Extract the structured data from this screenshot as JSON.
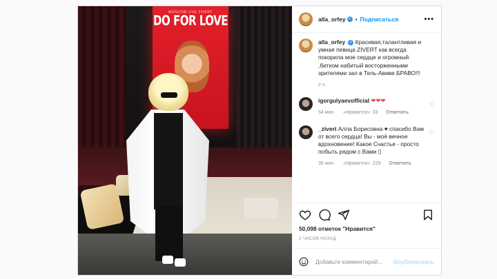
{
  "photo": {
    "screen_small_text": "MOSCOW LIVE ZIVERT",
    "screen_big_text": "DO FOR LOVE"
  },
  "header": {
    "username": "alla_orfey",
    "separator": "•",
    "follow_label": "Подписаться",
    "more_label": "•••"
  },
  "caption": {
    "username": "alla_orfey",
    "text": "Красивая,талантливая и умная певица ZIVERT как всегда покорила мое сердце и огромный ,битком набитый восторженными зрителями зал в Тель-Авиве.БРАВО!!!",
    "time": "2 ч."
  },
  "comments": [
    {
      "username": "igorgulyaevofficial",
      "text": "❤❤❤",
      "time": "54 мин.",
      "likes": "«Нравится»: 33",
      "reply": "Ответить"
    },
    {
      "username": "_zivert",
      "text": "Алла Борисовна ♥ спасибо Вам от всего сердца! Вы - моё вечное вдохновение! Какое Счастье - просто побыть рядом с Вами ▯",
      "time": "38 мин.",
      "likes": "«Нравится»: 229",
      "reply": "Ответить"
    }
  ],
  "actions": {
    "likes_count": "50,098 отметок \"Нравится\"",
    "timestamp": "2 ЧАСОВ НАЗАД"
  },
  "add_comment": {
    "placeholder": "Добавьте комментарий...",
    "post_label": "Опубликовать"
  },
  "colors": {
    "link_blue": "#0095f6",
    "verified_blue": "#3897f0",
    "heart_red": "#ed4956"
  }
}
